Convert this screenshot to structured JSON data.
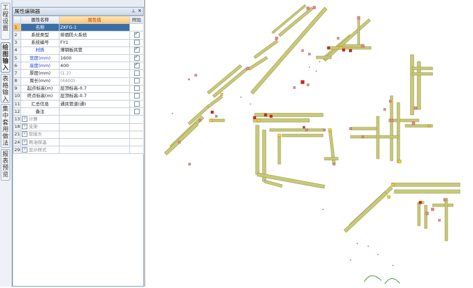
{
  "vertical_tabs": [
    {
      "label": "工程设置",
      "active": false
    },
    {
      "label": "绘图输入",
      "active": true
    },
    {
      "label": "表格输入",
      "active": false
    },
    {
      "label": "集中套用做法",
      "active": false
    },
    {
      "label": "报表预览",
      "active": false
    }
  ],
  "property_panel": {
    "title": "属性编辑器",
    "pin_icon": "pin-icon",
    "close_icon": "close-icon",
    "headers": {
      "name": "属性名称",
      "value": "属性值",
      "extra": "附加"
    },
    "rows": [
      {
        "num": "1",
        "name": "名称",
        "value": "ZKFG-1",
        "checked": null,
        "name_color": "normal"
      },
      {
        "num": "2",
        "name": "系统类型",
        "value": "排烟防火系统",
        "checked": true,
        "name_color": "normal"
      },
      {
        "num": "3",
        "name": "系统编号",
        "value": "FY1",
        "checked": false,
        "name_color": "normal"
      },
      {
        "num": "4",
        "name": "材质",
        "value": "薄钢板风管",
        "checked": true,
        "name_color": "blue"
      },
      {
        "num": "5",
        "name": "宽度(mm)",
        "value": "1600",
        "checked": true,
        "name_color": "blue"
      },
      {
        "num": "6",
        "name": "高度(mm)",
        "value": "400",
        "checked": true,
        "name_color": "blue"
      },
      {
        "num": "7",
        "name": "厚度(mm)",
        "value": "(1.2)",
        "checked": false,
        "name_color": "normal"
      },
      {
        "num": "8",
        "name": "周长(mm)",
        "value": "(4400)",
        "checked": false,
        "name_color": "normal"
      },
      {
        "num": "9",
        "name": "起点标高(m)",
        "value": "层顶标高-0.7",
        "checked": false,
        "name_color": "normal"
      },
      {
        "num": "10",
        "name": "终点标高(m)",
        "value": "层顶标高-0.7",
        "checked": false,
        "name_color": "normal"
      },
      {
        "num": "11",
        "name": "汇总信息",
        "value": "通风管道(通)",
        "checked": false,
        "name_color": "normal"
      },
      {
        "num": "12",
        "name": "备注",
        "value": "",
        "checked": false,
        "name_color": "normal"
      }
    ],
    "groups": [
      {
        "num": "13",
        "name": "计算"
      },
      {
        "num": "18",
        "name": "支架"
      },
      {
        "num": "21",
        "name": "软接头"
      },
      {
        "num": "24",
        "name": "刷油保温"
      },
      {
        "num": "29",
        "name": "显示样式"
      }
    ]
  },
  "canvas": {
    "duct_color": "#c9c97a",
    "duct_stroke": "#8d8d3c",
    "fitting_color": "#f08a8a",
    "accent_yellow": "#f2e600",
    "accent_red": "#d8201a"
  }
}
